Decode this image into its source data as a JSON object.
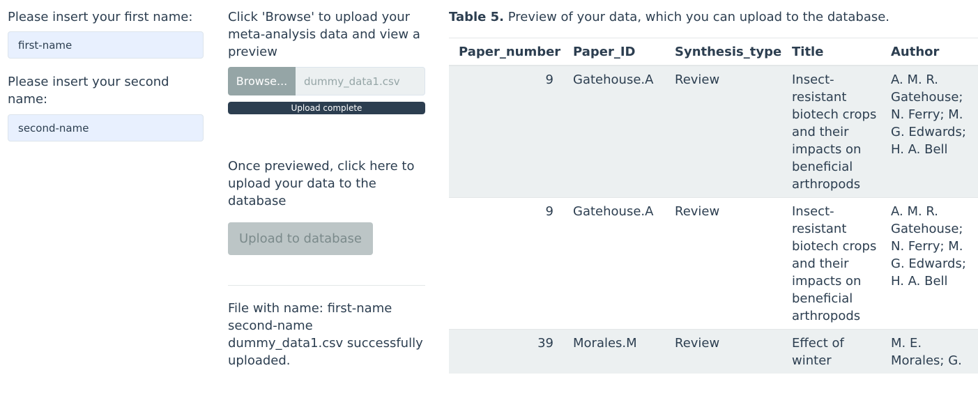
{
  "form": {
    "first_name_label": "Please insert your first name:",
    "first_name_value": "first-name",
    "second_name_label": "Please insert your second name:",
    "second_name_value": "second-name"
  },
  "upload": {
    "browse_instruction": "Click 'Browse' to upload your meta-analysis data and view a preview",
    "browse_button_label": "Browse...",
    "file_name": "dummy_data1.csv",
    "progress_label": "Upload complete",
    "progress_fraction": 1.0,
    "preview_instruction": "Once previewed, click here to upload your data to the database",
    "upload_button_label": "Upload to database",
    "success_message": "File with name: first-name second-name dummy_data1.csv successfully uploaded."
  },
  "table": {
    "caption_bold": "Table 5.",
    "caption_text": " Preview of your data, which you can upload to the database.",
    "headers": [
      "Paper_number",
      "Paper_ID",
      "Synthesis_type",
      "Title",
      "Author"
    ],
    "rows": [
      {
        "paper_number": "9",
        "paper_id": "Gatehouse.A",
        "synthesis_type": "Review",
        "title": "Insect-resistant biotech crops and their impacts on beneficial arthropods",
        "author": "A. M. R. Gatehouse; N. Ferry; M. G. Edwards; H. A. Bell"
      },
      {
        "paper_number": "9",
        "paper_id": "Gatehouse.A",
        "synthesis_type": "Review",
        "title": "Insect-resistant biotech crops and their impacts on beneficial arthropods",
        "author": "A. M. R. Gatehouse; N. Ferry; M. G. Edwards; H. A. Bell"
      },
      {
        "paper_number": "39",
        "paper_id": "Morales.M",
        "synthesis_type": "Review",
        "title": "Effect of winter",
        "author": "M. E. Morales; G."
      }
    ]
  },
  "colors": {
    "text": "#2c3e50",
    "input_bg": "#e8f0fe",
    "browse_bg": "#95a5a6",
    "progress_bar": "#2c3e50",
    "upload_disabled_bg": "#bcc5c6",
    "stripe": "#ecf0f1"
  }
}
